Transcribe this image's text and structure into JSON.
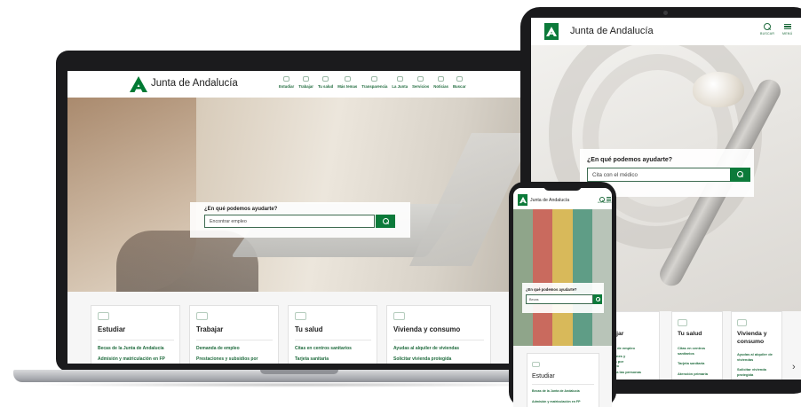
{
  "brand_name": "Junta de Andalucía",
  "laptop": {
    "nav": [
      {
        "label": "Estudiar",
        "icon": "graduation-cap-icon"
      },
      {
        "label": "Trabajar",
        "icon": "briefcase-icon"
      },
      {
        "label": "Tu salud",
        "icon": "heart-pulse-icon"
      },
      {
        "label": "Más temas",
        "icon": "grid-icon"
      },
      {
        "label": "Transparencia",
        "icon": "info-icon"
      },
      {
        "label": "La Junta",
        "icon": "building-icon"
      },
      {
        "label": "Servicios",
        "icon": "document-icon"
      },
      {
        "label": "Noticias",
        "icon": "newspaper-icon"
      },
      {
        "label": "Buscar",
        "icon": "search-icon"
      }
    ],
    "search": {
      "question": "¿En qué podemos ayudarte?",
      "value": "Encontrar empleo"
    },
    "cards": [
      {
        "title": "Estudiar",
        "icon": "graduation-cap-icon",
        "links": [
          "Becas de la Junta de Andalucía",
          "Admisión y matriculación en FP"
        ]
      },
      {
        "title": "Trabajar",
        "icon": "briefcase-icon",
        "links": [
          "Demanda de empleo",
          "Prestaciones y subsidios por"
        ]
      },
      {
        "title": "Tu salud",
        "icon": "heart-pulse-icon",
        "links": [
          "Citas en centros sanitarios",
          "Tarjeta sanitaria"
        ]
      },
      {
        "title": "Vivienda y consumo",
        "icon": "house-icon",
        "links": [
          "Ayudas al alquiler de viviendas",
          "Solicitar vivienda protegida"
        ]
      }
    ]
  },
  "tablet": {
    "search_label": "BUSCAR",
    "menu_label": "MENÚ",
    "search": {
      "question": "¿En qué podemos ayudarte?",
      "value": "Cita con el médico"
    },
    "cards": [
      {
        "title": "Trabajar",
        "icon": "briefcase-icon",
        "links": [
          "Demanda de empleo",
          "Prestaciones y subsidios por desempleo",
          "Atención a las personas"
        ]
      },
      {
        "title": "Tu salud",
        "icon": "heart-pulse-icon",
        "links": [
          "Citas en centros sanitarios",
          "Tarjeta sanitaria",
          "Atención primaria"
        ]
      },
      {
        "title": "Vivienda y consumo",
        "icon": "house-icon",
        "links": [
          "Ayudas al alquiler de viviendas",
          "Solicitar vivienda protegida"
        ]
      }
    ]
  },
  "phone": {
    "search_label": "BUSCAR",
    "menu_label": "MENÚ",
    "search": {
      "question": "¿En qué podemos ayudarte?",
      "value": "Becas"
    },
    "card": {
      "title": "Estudiar",
      "icon": "graduation-cap-icon",
      "links": [
        "Becas de la Junta de Andalucía",
        "Admisión y matriculación en FP"
      ]
    }
  },
  "colors": {
    "brand_green": "#007a33",
    "button_green": "#0c7a3a",
    "device_dark": "#1b1b1d"
  }
}
